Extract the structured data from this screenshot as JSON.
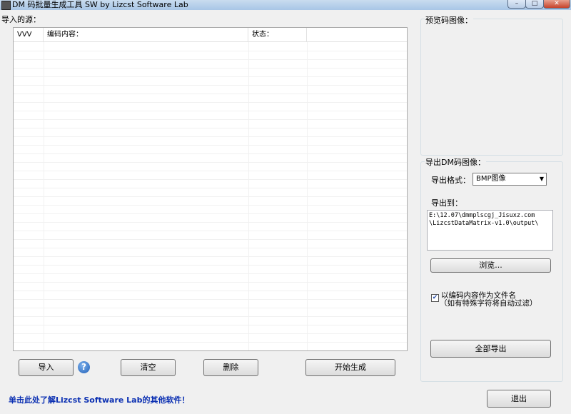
{
  "window": {
    "title": "DM 码批量生成工具 SW   by Lizcst Software Lab",
    "controls": {
      "minimize": "–",
      "maximize": "□",
      "close": "✕"
    }
  },
  "source": {
    "label": "导入的源：",
    "columns": [
      "VVV",
      "编码内容：",
      "状态：",
      ""
    ]
  },
  "preview": {
    "label": "预览码图像："
  },
  "export": {
    "group_label": "导出DM码图像：",
    "format_label": "导出格式：",
    "format_value": "BMP图像",
    "dest_label": "导出到：",
    "path": "E:\\12.07\\dmmplscgj_Jisuxz.com\n\\LizcstDataMatrix-v1.0\\output\\",
    "browse_button": "浏览...",
    "filename_checkbox": {
      "checked": true,
      "label_line1": "以编码内容作为文件名",
      "label_line2": "（如有特殊字符将自动过滤）"
    },
    "export_all_button": "全部导出"
  },
  "buttons": {
    "import": "导入",
    "help": "?",
    "clear": "清空",
    "delete": "删除",
    "start": "开始生成",
    "exit": "退出"
  },
  "footer_link": "单击此处了解Lizcst Software Lab的其他软件！",
  "icons": {
    "app": "app-icon",
    "help": "help-icon",
    "dropdown": "dropdown-arrow-icon",
    "check": "checkmark-icon"
  }
}
